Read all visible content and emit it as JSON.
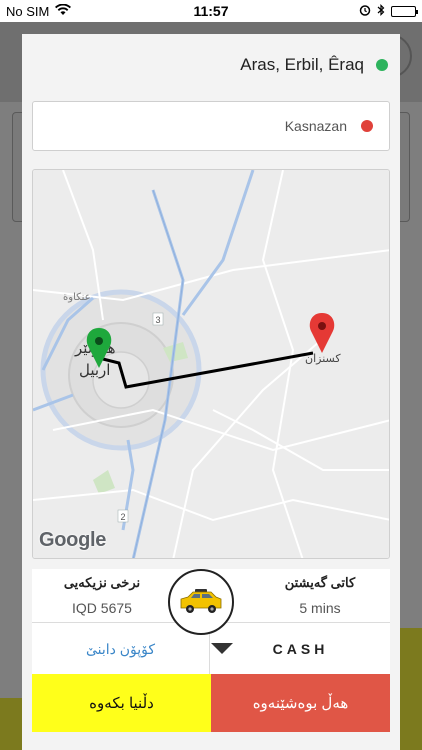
{
  "status_bar": {
    "carrier": "No SIM",
    "time": "11:57"
  },
  "route": {
    "origin": "Aras, Erbil, Êraq",
    "origin_color": "#2db35d",
    "destination": "Kasnazan",
    "destination_color": "#e0413a"
  },
  "map": {
    "labels": [
      "عنكاوة",
      "هەولێر",
      "اربيل",
      "كسنزان",
      "3",
      "2"
    ],
    "provider_logo": "Google",
    "route_color": "#000000",
    "start_marker_color": "#1ea83c",
    "end_marker_color": "#e53935"
  },
  "trip_info": {
    "price_title": "نرخی نزیکەیی",
    "price_value": "IQD 5675",
    "arrival_title": "کاتی گەیشتن",
    "arrival_value": "5 mins",
    "vehicle_icon": "taxi-icon"
  },
  "options": {
    "coupon_label": "کۆپۆن دابنێ",
    "payment_label": "CASH",
    "accent_color": "#3a86c8"
  },
  "actions": {
    "confirm_label": "دڵنیا بکەوە",
    "cancel_label": "هەڵ بوەشێنەوە",
    "confirm_color": "#ffff1a",
    "cancel_color": "#e05646"
  }
}
